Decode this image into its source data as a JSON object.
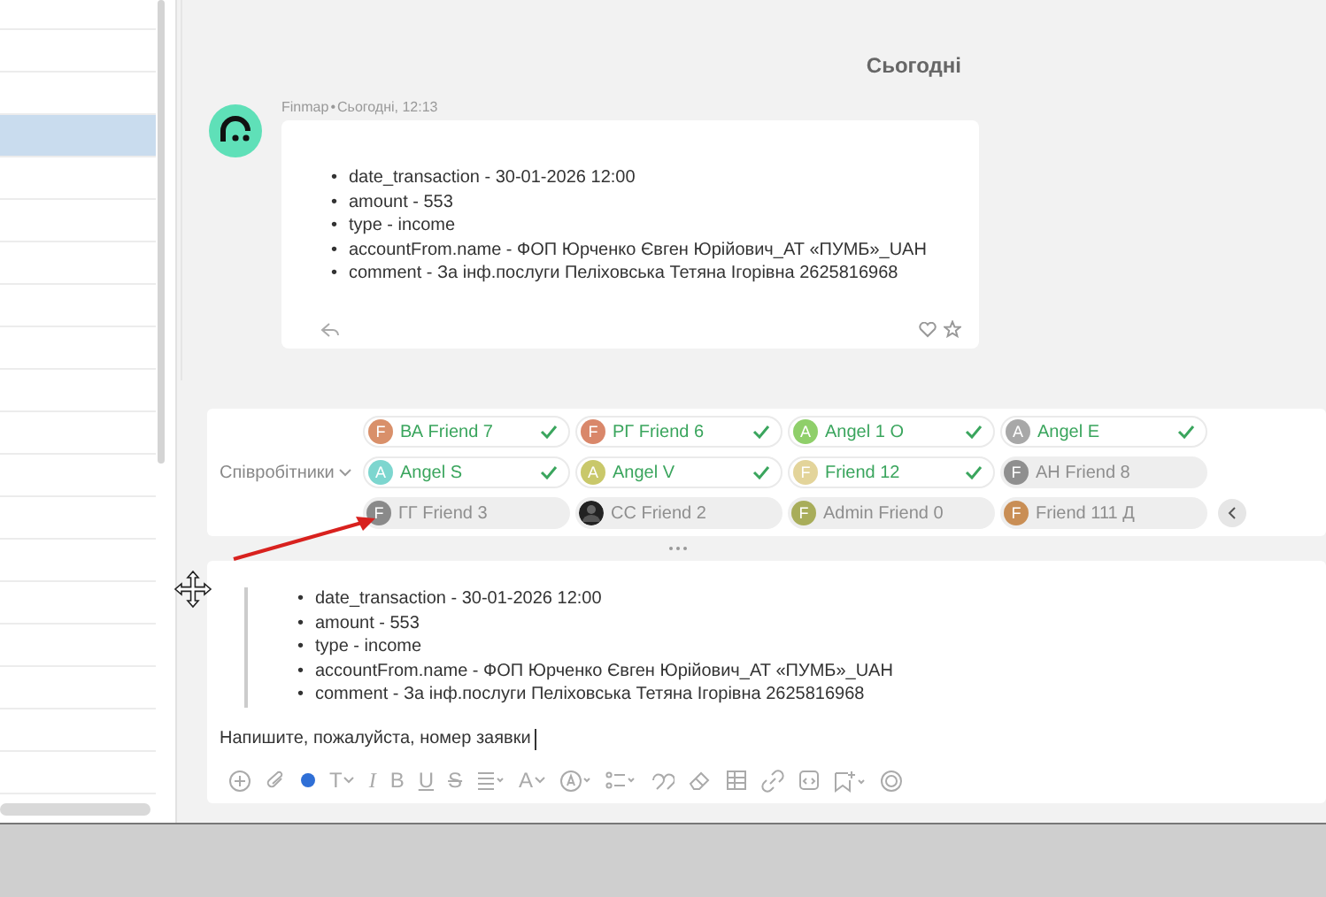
{
  "list": {
    "rows": [
      {
        "selected": false
      },
      {
        "selected": false
      },
      {
        "selected": false
      },
      {
        "selected": true
      },
      {
        "selected": false
      },
      {
        "selected": false
      },
      {
        "selected": false
      },
      {
        "selected": false
      },
      {
        "selected": false
      },
      {
        "selected": false
      },
      {
        "selected": false
      },
      {
        "selected": false
      },
      {
        "selected": false
      },
      {
        "selected": false
      },
      {
        "selected": false
      },
      {
        "selected": false
      },
      {
        "selected": false
      },
      {
        "selected": false
      },
      {
        "selected": false
      }
    ]
  },
  "chat": {
    "date_divider": "Сьогодні",
    "message": {
      "sender": "Finmap",
      "separator": "•",
      "time": "Сьогодні, 12:13",
      "bullet": "•",
      "items": [
        "date_transaction - 30-01-2026 12:00",
        "amount - 553",
        "type - income",
        "accountFrom.name - ФОП Юрченко Євген Юрійович_АТ «ПУМБ»_UAH",
        "comment - За інф.послуги Пеліховська Тетяна Ігорівна 2625816968"
      ]
    }
  },
  "assignees": {
    "label": "Співробітники",
    "chips": [
      {
        "name": "ВА Friend 7",
        "kind": "initial",
        "initial": "F",
        "color": "#d9906a",
        "selected": true
      },
      {
        "name": "РГ Friend 6",
        "kind": "initial",
        "initial": "F",
        "color": "#d9876a",
        "selected": true
      },
      {
        "name": "Angel 1 O",
        "kind": "initial",
        "initial": "A",
        "color": "#8fcf6a",
        "selected": true
      },
      {
        "name": "Angel E",
        "kind": "initial",
        "initial": "A",
        "color": "#a8a8a8",
        "selected": true
      },
      {
        "name": "Angel S",
        "kind": "initial",
        "initial": "A",
        "color": "#7dd6cf",
        "selected": true
      },
      {
        "name": "Angel V",
        "kind": "initial",
        "initial": "A",
        "color": "#c9c86a",
        "selected": true
      },
      {
        "name": "Friend 12",
        "kind": "initial",
        "initial": "F",
        "color": "#e3d49a",
        "selected": true
      },
      {
        "name": "АН Friend 8",
        "kind": "initial",
        "initial": "F",
        "color": "#8f8f8f",
        "selected": false
      },
      {
        "name": "ГГ Friend 3",
        "kind": "initial",
        "initial": "F",
        "color": "#8a8a8a",
        "selected": false
      },
      {
        "name": "CC Friend 2",
        "kind": "picture",
        "selected": false
      },
      {
        "name": "Admin Friend 0",
        "kind": "initial",
        "initial": "F",
        "color": "#a8ad5a",
        "selected": false
      },
      {
        "name": "Friend 111 Д",
        "kind": "initial",
        "initial": "F",
        "color": "#c98e55",
        "selected": false
      }
    ]
  },
  "composer": {
    "bullet": "•",
    "quote": [
      "date_transaction - 30-01-2026 12:00",
      "amount - 553",
      "type - income",
      "accountFrom.name - ФОП Юрченко Євген Юрійович_АТ «ПУМБ»_UAH",
      "comment - За інф.послуги Пеліховська Тетяна Ігорівна 2625816968"
    ],
    "value": "Напишите, пожалуйста, номер заявки",
    "format_glyphs": [
      "T",
      "I",
      "B",
      "U",
      "S",
      "A"
    ]
  }
}
